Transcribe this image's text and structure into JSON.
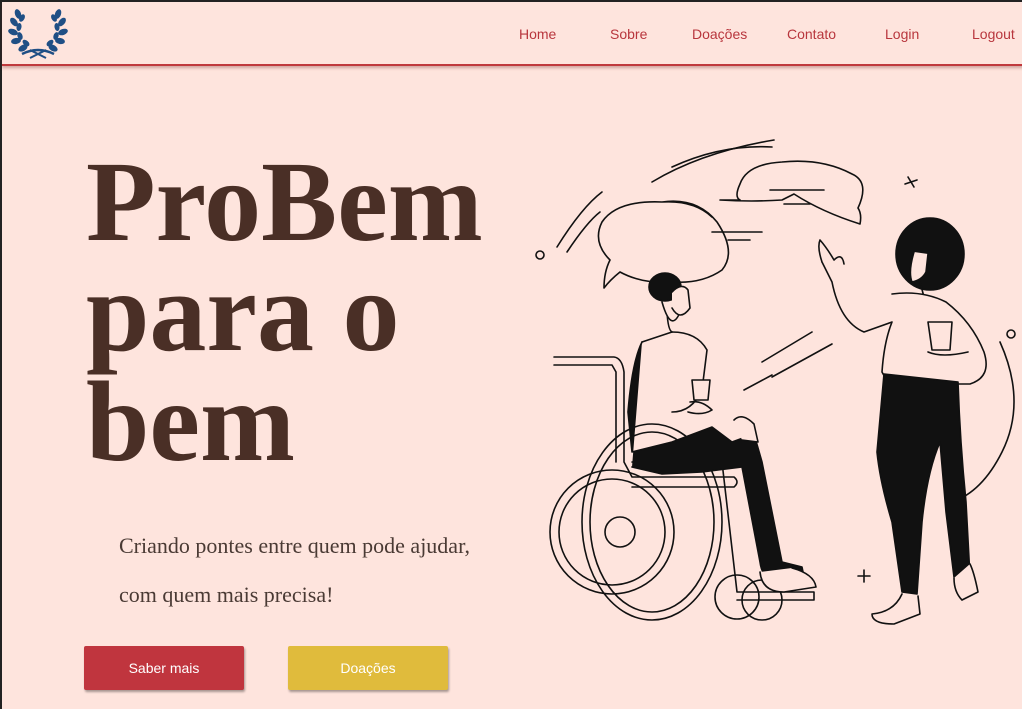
{
  "nav": {
    "links": [
      "Home",
      "Sobre",
      "Doações",
      "Contato",
      "Login",
      "Logout"
    ]
  },
  "hero": {
    "title_line1": "ProBem",
    "title_line2": "para o",
    "title_line3": "bem",
    "subtitle_line1": "Criando pontes entre quem pode ajudar,",
    "subtitle_line2": "com quem mais precisa!"
  },
  "buttons": {
    "learn_more": "Saber mais",
    "donations": "Doações"
  },
  "colors": {
    "background": "#fee4dd",
    "accent_red": "#c0353e",
    "accent_yellow": "#e0bb3c",
    "title_brown": "#4a2f26",
    "logo_blue": "#1f4f85"
  },
  "icons": {
    "logo": "laurel-wreath-icon",
    "illustration": "people-talking-illustration"
  }
}
